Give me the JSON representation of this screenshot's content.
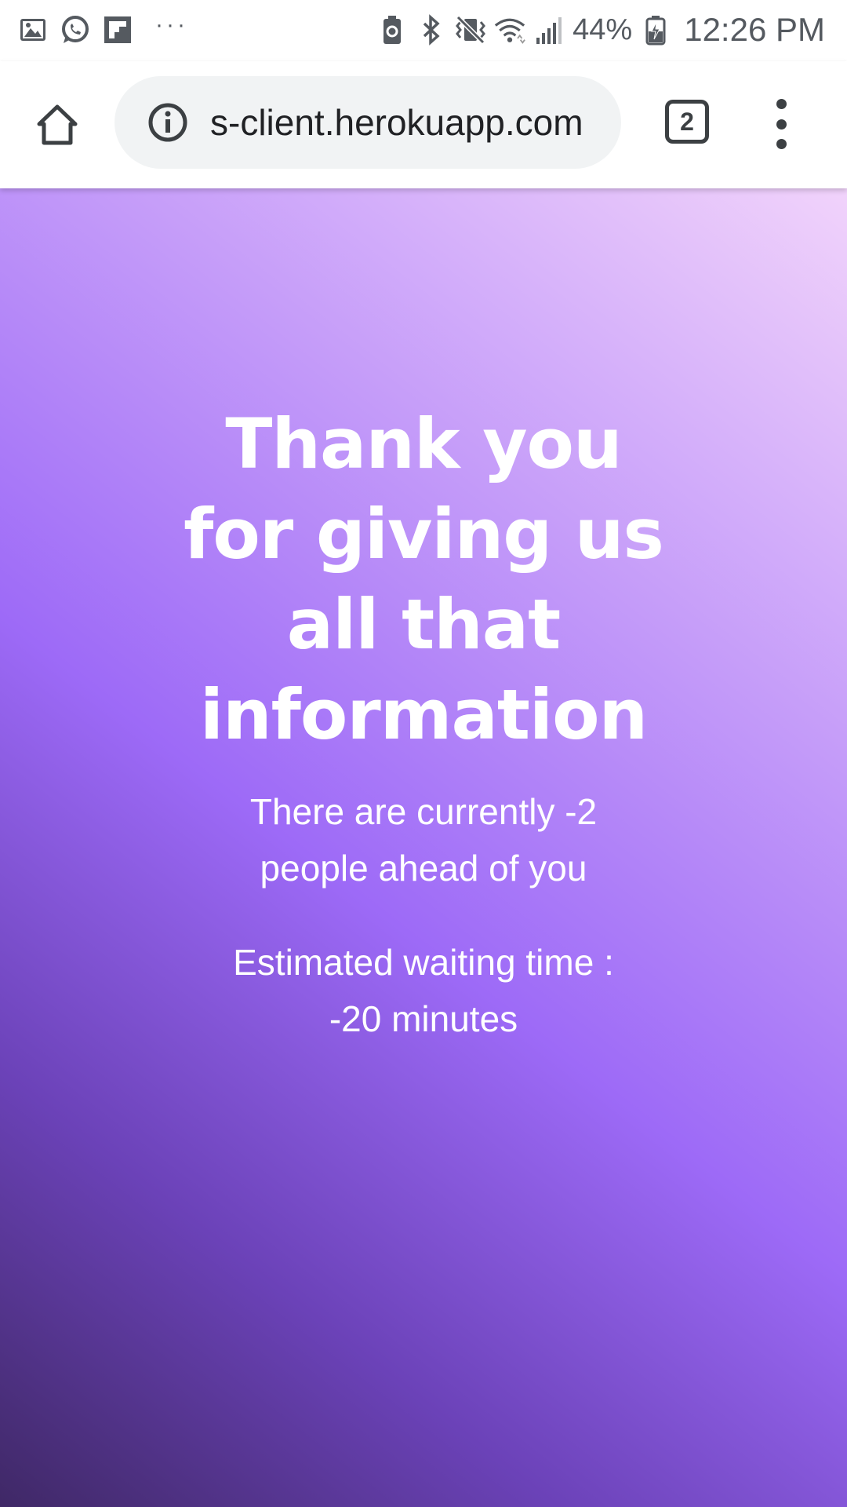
{
  "status_bar": {
    "notification_icons": [
      "gallery-icon",
      "whatsapp-icon",
      "flipboard-icon"
    ],
    "more_indicator": "···",
    "system_icons": [
      "battery-saver-icon",
      "bluetooth-icon",
      "vibrate-icon",
      "wifi-icon",
      "signal-icon",
      "battery-icon"
    ],
    "battery_percent": "44%",
    "time": "12:26 PM"
  },
  "browser": {
    "url": "s-client.herokuapp.com",
    "tab_count": "2",
    "icons": {
      "home": "home-icon",
      "site_info": "info-icon",
      "tabs": "tab-switcher-icon",
      "menu": "more-vert-icon"
    }
  },
  "page": {
    "heading_lines": [
      "Thank you",
      "for giving us",
      "all that",
      "information"
    ],
    "queue_lines": [
      "There are currently -2",
      "people ahead of you"
    ],
    "wait_lines": [
      "Estimated waiting time :",
      "-20 minutes"
    ]
  },
  "colors": {
    "gradient_dark": "#3f2866",
    "gradient_mid": "#9d6af7",
    "gradient_light": "#f1d3fb",
    "text": "#ffffff",
    "omnibox_bg": "#f1f3f4"
  }
}
